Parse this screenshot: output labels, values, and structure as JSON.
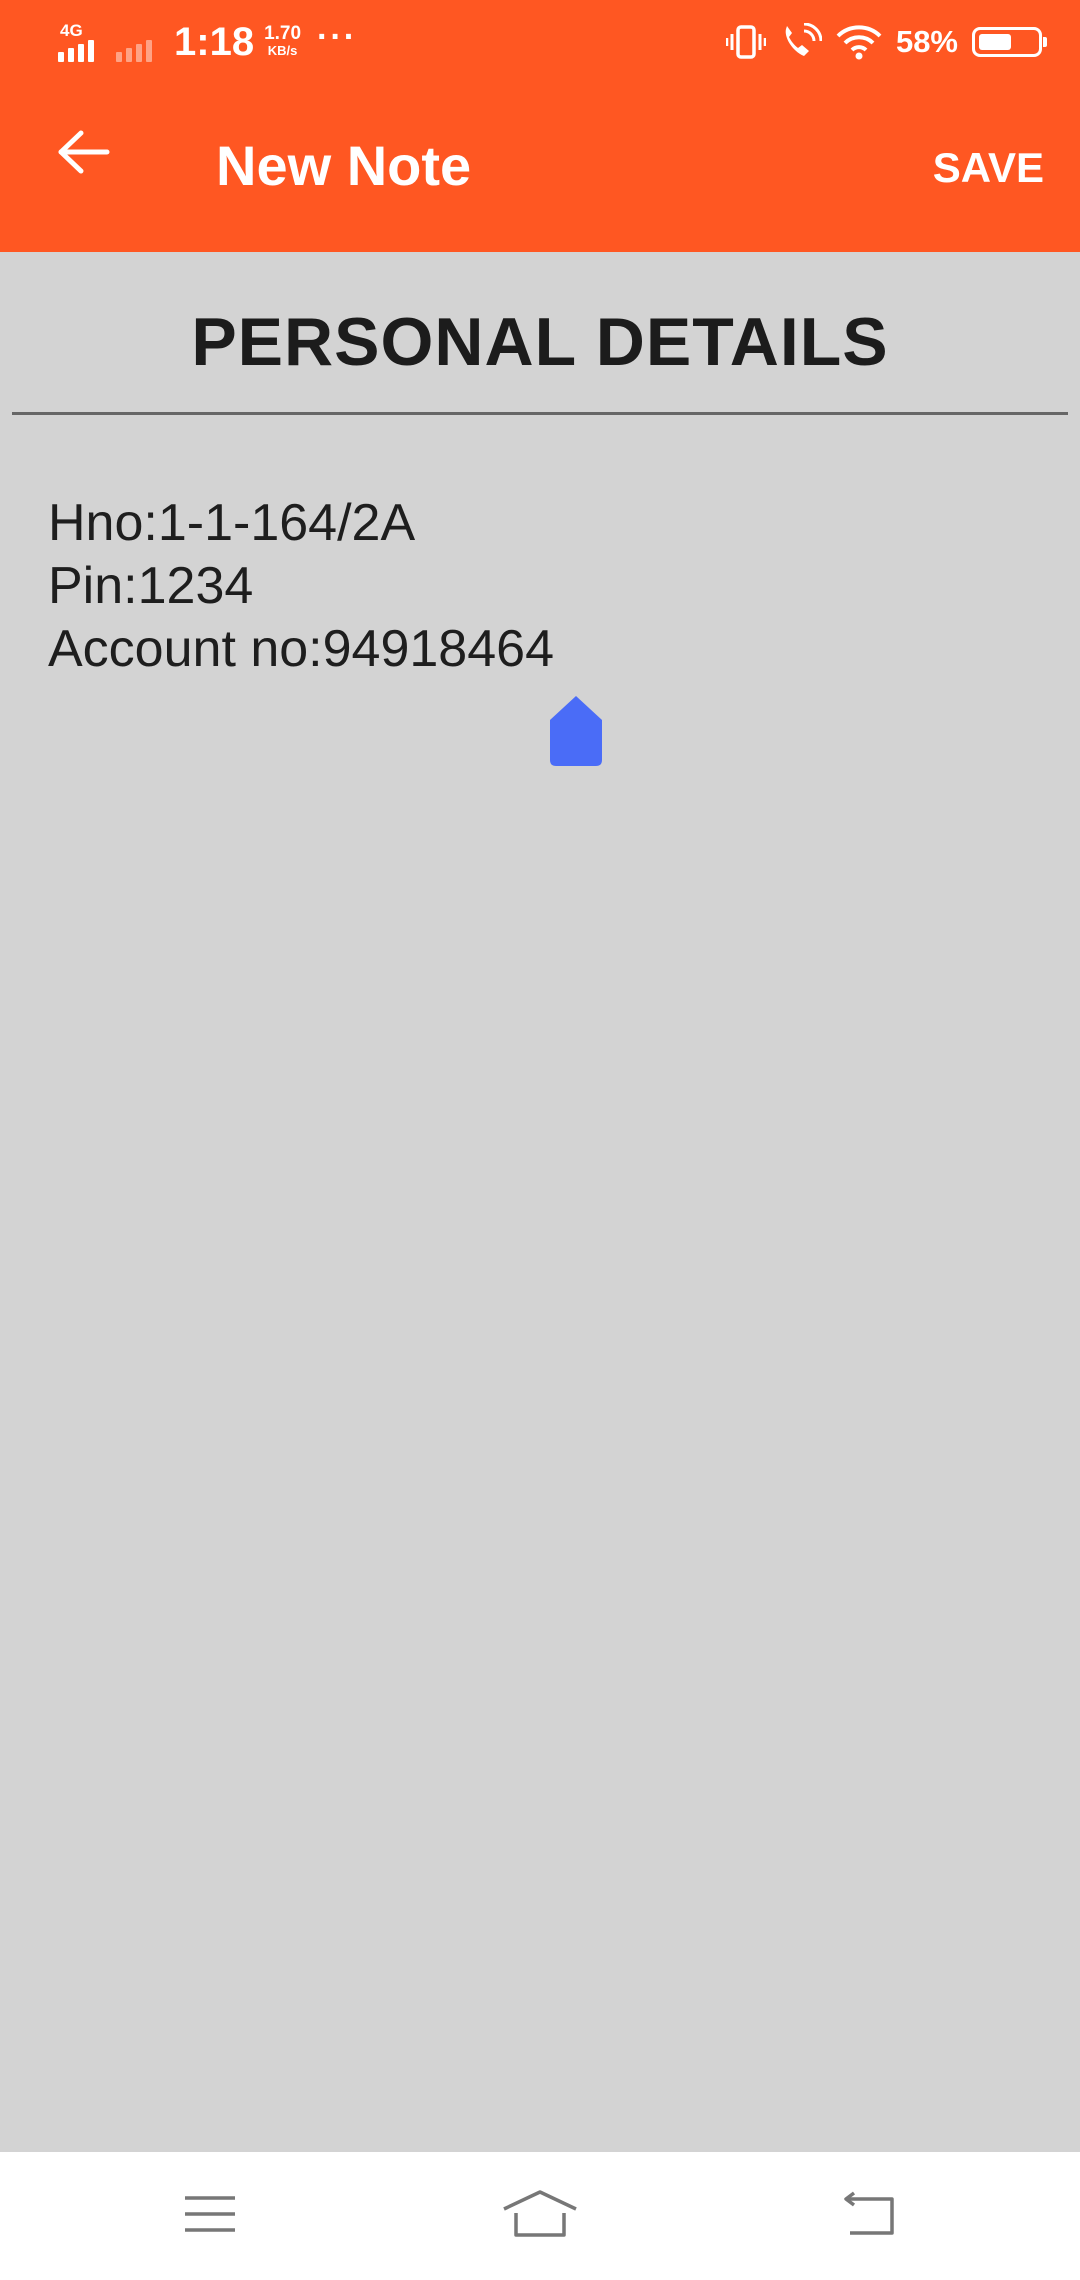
{
  "status_bar": {
    "network_type": "4G",
    "time": "1:18",
    "speed_value": "1.70",
    "speed_unit": "KB/s",
    "more": "···",
    "battery_percent": "58%",
    "battery_level": 0.58,
    "icons": [
      "signal-icon",
      "signal-icon-2",
      "vibrate-icon",
      "wifi-calling-icon",
      "wifi-icon",
      "battery-icon"
    ]
  },
  "app_bar": {
    "title": "New Note",
    "save_label": "SAVE",
    "back_icon": "arrow-back-icon",
    "color": "#ff5722"
  },
  "note": {
    "heading": "PERSONAL DETAILS",
    "lines": [
      "Hno:1-1-164/2A",
      "Pin:1234",
      "Account no:94918464"
    ],
    "cursor_color": "#4a6cf7"
  },
  "nav_bar": {
    "icons": [
      "menu-icon",
      "home-icon",
      "back-icon"
    ]
  },
  "colors": {
    "background": "#d3d3d3",
    "accent": "#ff5722"
  }
}
